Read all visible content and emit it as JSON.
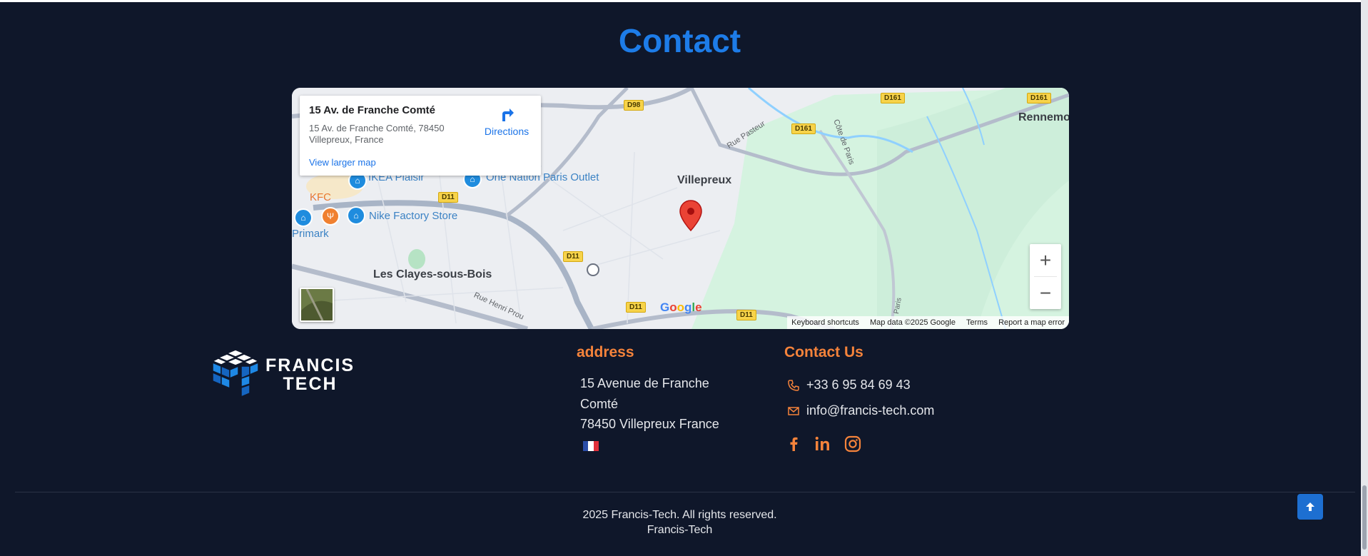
{
  "section": {
    "title": "Contact"
  },
  "map": {
    "card": {
      "place_name": "15 Av. de Franche Comté",
      "place_address": "15 Av. de Franche Comté, 78450 Villepreux, France",
      "directions": "Directions",
      "view_larger": "View larger map"
    },
    "towns": [
      "Villepreux",
      "Les Clayes-sous-Bois",
      "Rennemo"
    ],
    "pois": [
      "IKEA Plaisir",
      "One Nation Paris Outlet",
      "Nike Factory Store",
      "KFC",
      "Primark"
    ],
    "roads": [
      "D98",
      "D161",
      "D161",
      "D161",
      "D11",
      "D11",
      "D11",
      "D11"
    ],
    "streets": [
      "Rue Pasteur",
      "Côte de Paris",
      "Rue Henri Prou",
      "Paris"
    ],
    "logo": "Google",
    "zoom_in": "+",
    "zoom_out": "−",
    "attribution": [
      "Keyboard shortcuts",
      "Map data ©2025 Google",
      "Terms",
      "Report a map error"
    ]
  },
  "footer": {
    "logo": {
      "line1": "FRANCIS",
      "line2": "TECH"
    },
    "address": {
      "title": "address",
      "line1": "15 Avenue de Franche",
      "line2": "Comté",
      "line3": "78450 Villepreux France"
    },
    "contact": {
      "title": "Contact Us",
      "phone": "+33 6 95 84 69 43",
      "email": "info@francis-tech.com"
    },
    "social_icons": [
      "facebook-icon",
      "linkedin-icon",
      "instagram-icon"
    ],
    "copyright": "2025 Francis-Tech. All rights reserved.",
    "brand": "Francis-Tech"
  },
  "colors": {
    "background": "#0f172a",
    "title_blue": "#1d7ce8",
    "accent_orange": "#f5833b",
    "button_blue": "#1d6fd1"
  }
}
